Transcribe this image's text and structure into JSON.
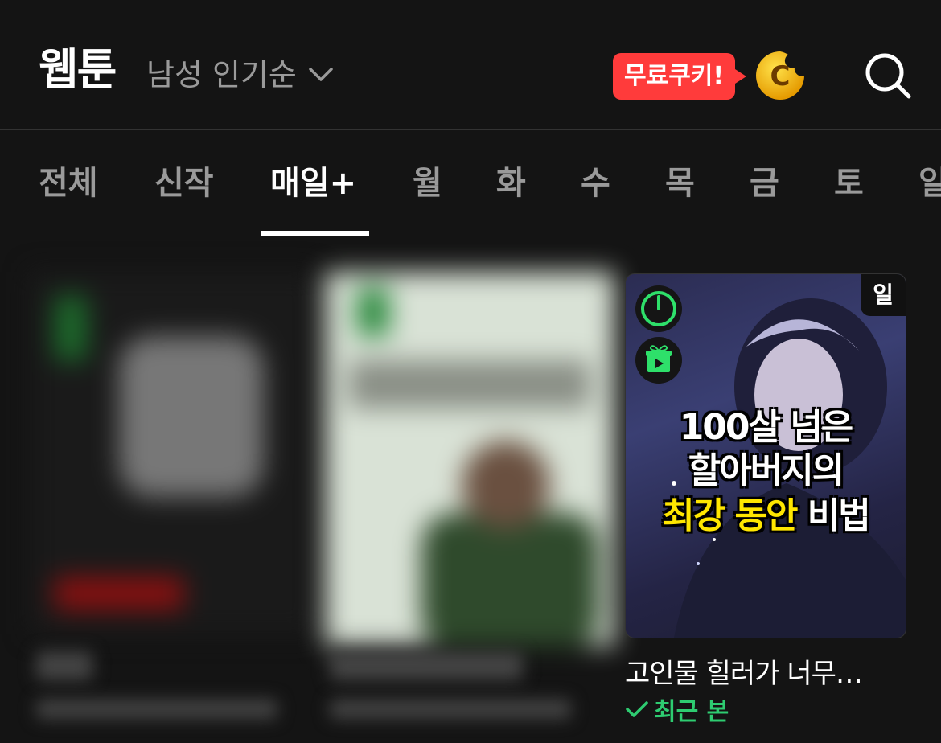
{
  "header": {
    "title": "웹툰",
    "sort_label": "남성 인기순",
    "promo_label": "무료쿠키!",
    "cookie_letter": "C",
    "icons": {
      "sort": "chevron-down-icon",
      "search": "search-icon",
      "cookie": "cookie-coin-icon"
    }
  },
  "tabs": [
    {
      "label": "전체",
      "active": false
    },
    {
      "label": "신작",
      "active": false
    },
    {
      "label": "매일+",
      "active": true
    },
    {
      "label": "월",
      "active": false
    },
    {
      "label": "화",
      "active": false
    },
    {
      "label": "수",
      "active": false
    },
    {
      "label": "목",
      "active": false
    },
    {
      "label": "금",
      "active": false
    },
    {
      "label": "토",
      "active": false
    },
    {
      "label": "일",
      "active": false
    }
  ],
  "cards": {
    "featured": {
      "day_badge": "일",
      "cover_line1": "100살 넘은",
      "cover_line2": "할아버지의",
      "cover_line3_highlight": "최강 동안",
      "cover_line3_rest": " 비법",
      "title": "고인물 힐러가 너무…",
      "recent_label": "최근 본",
      "icons": [
        "timer-icon",
        "gift-video-icon",
        "check-icon"
      ]
    }
  },
  "colors": {
    "background": "#141414",
    "promo": "#ff3b3b",
    "recent": "#2ecc71",
    "highlight": "#ffe600"
  }
}
